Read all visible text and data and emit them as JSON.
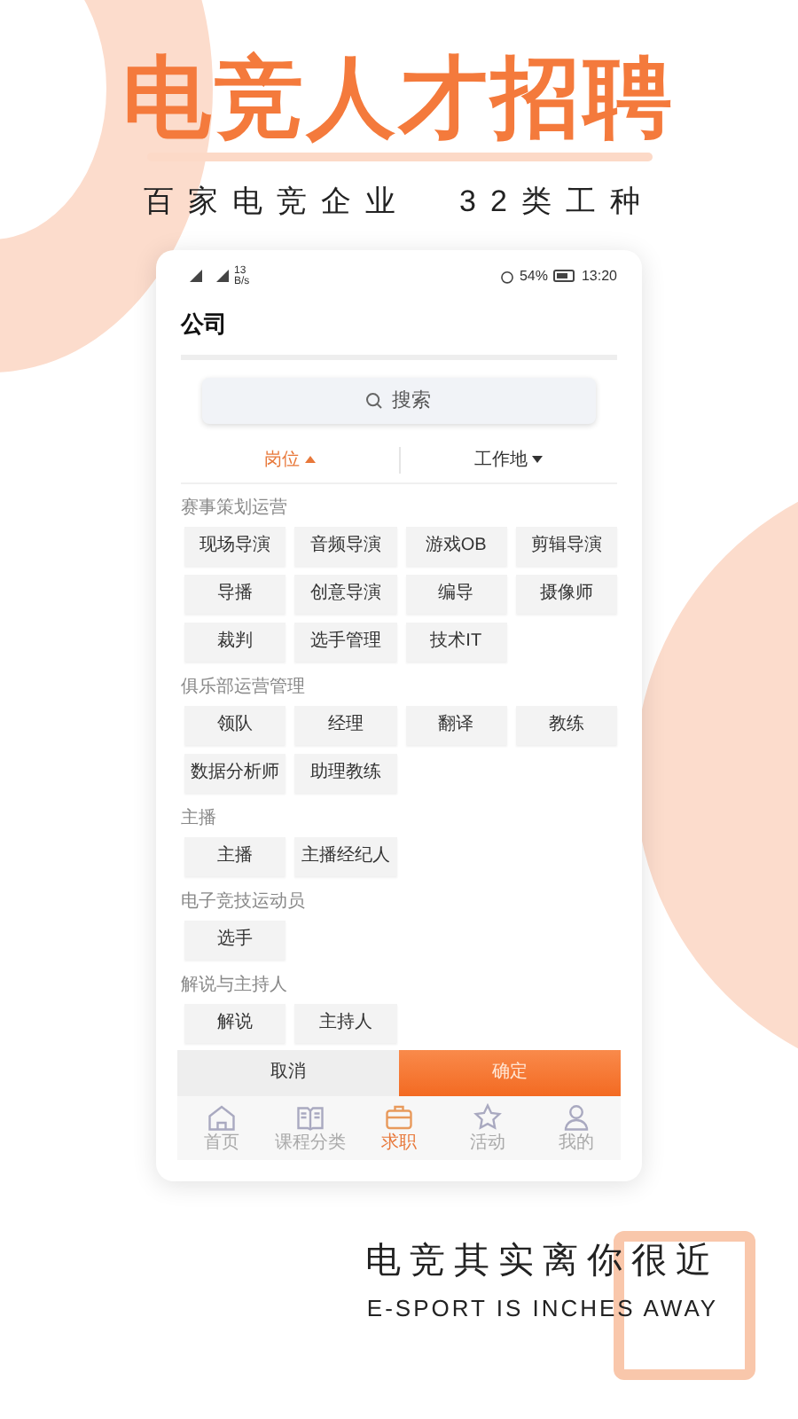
{
  "headline": "电竞人才招聘",
  "subheadline": [
    "百家电竞企业",
    "32类工种"
  ],
  "phone": {
    "status_bar": {
      "net_speed": "13 B/s",
      "battery": "54%",
      "time": "13:20"
    },
    "title": "公司",
    "search": {
      "placeholder": "搜索"
    },
    "filter_tabs": [
      {
        "label": "岗位",
        "selected": true
      },
      {
        "label": "工作地",
        "selected": false
      }
    ],
    "sections": [
      {
        "title": "赛事策划运营",
        "tags": [
          "现场导演",
          "音频导演",
          "游戏OB",
          "剪辑导演",
          "导播",
          "创意导演",
          "编导",
          "摄像师",
          "裁判",
          "选手管理",
          "技术IT"
        ]
      },
      {
        "title": "俱乐部运营管理",
        "tags": [
          "领队",
          "经理",
          "翻译",
          "教练",
          "数据分析师",
          "助理教练"
        ]
      },
      {
        "title": "主播",
        "tags": [
          "主播",
          "主播经纪人"
        ]
      },
      {
        "title": "电子竞技运动员",
        "tags": [
          "选手"
        ]
      },
      {
        "title": "解说与主持人",
        "tags": [
          "解说",
          "主持人"
        ]
      }
    ],
    "actions": [
      {
        "label": "取消",
        "kind": "cancel"
      },
      {
        "label": "确定",
        "kind": "confirm"
      }
    ],
    "nav": [
      {
        "label": "首页",
        "kind": "home",
        "selected": false
      },
      {
        "label": "课程分类",
        "kind": "book",
        "selected": false
      },
      {
        "label": "求职",
        "kind": "briefcase",
        "selected": true
      },
      {
        "label": "活动",
        "kind": "star",
        "selected": false
      },
      {
        "label": "我的",
        "kind": "person",
        "selected": false
      }
    ]
  },
  "tagline": "电竞其实离你很近",
  "tagline_en": "E-SPORT IS INCHES AWAY"
}
